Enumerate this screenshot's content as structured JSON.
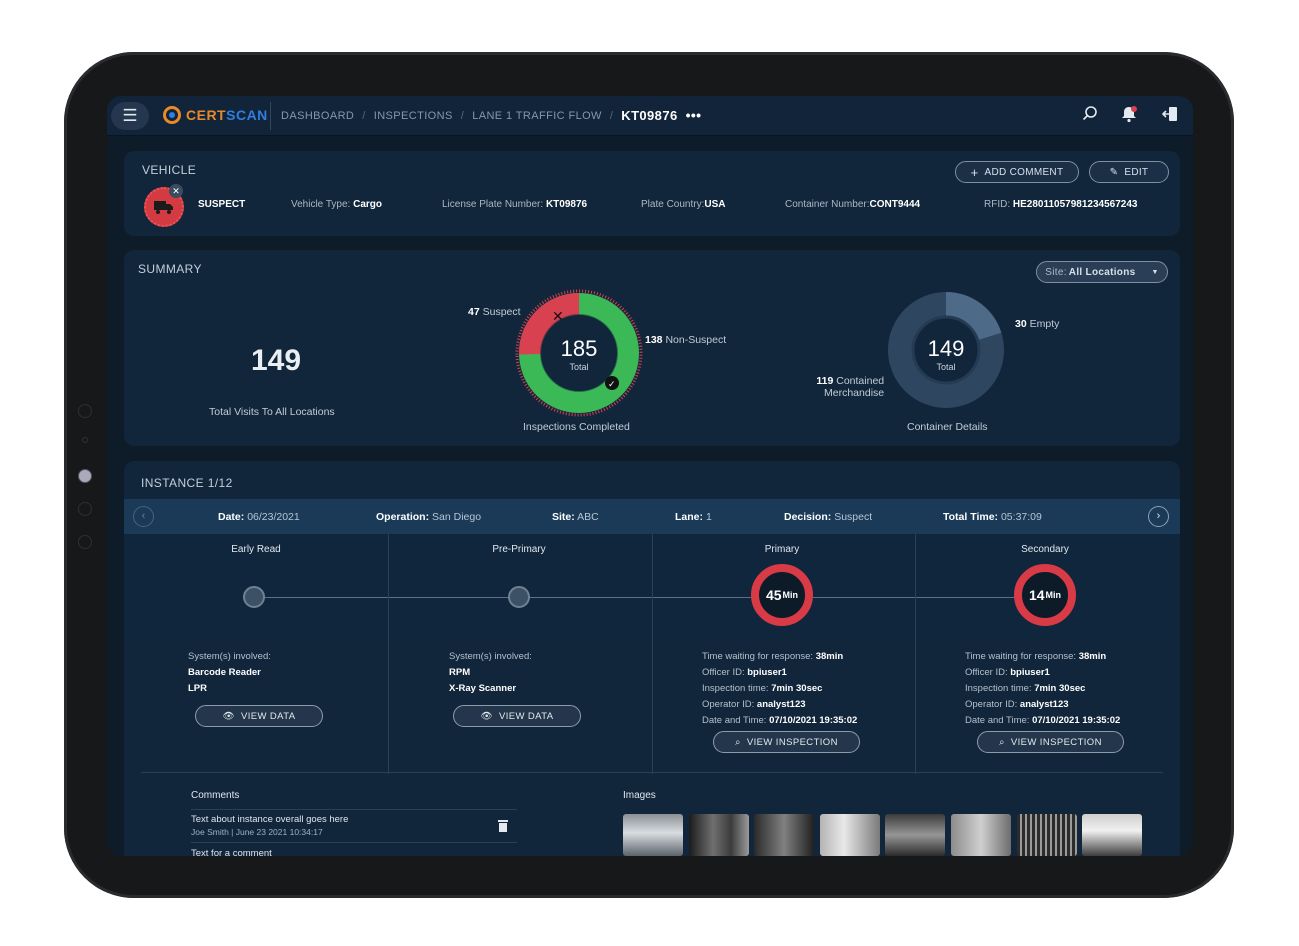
{
  "topbar": {
    "logo_part1": "CERT",
    "logo_part2": "SCAN",
    "crumbs": [
      "DASHBOARD",
      "INSPECTIONS",
      "LANE 1 TRAFFIC FLOW"
    ],
    "current": "KT09876",
    "more": "•••"
  },
  "vehicle": {
    "title": "VEHICLE",
    "add_comment": "ADD COMMENT",
    "edit": "EDIT",
    "status": "SUSPECT",
    "type_label": "Vehicle Type:",
    "type_value": "Cargo",
    "plate_label": "License Plate Number:",
    "plate_value": "KT09876",
    "country_label": "Plate Country:",
    "country_value": "USA",
    "container_label": "Container Number:",
    "container_value": "CONT9444",
    "rfid_label": "RFID:",
    "rfid_value": "HE2801105798123456724 3"
  },
  "summary": {
    "title": "SUMMARY",
    "site_label": "Site:",
    "site_value": "All Locations",
    "visits_value": "149",
    "visits_label": "Total Visits To All Locations",
    "inspections": {
      "total": "185",
      "total_label": "Total",
      "suspect_num": "47",
      "suspect_label": "Suspect",
      "nonsuspect_num": "138",
      "nonsuspect_label": "Non-Suspect",
      "caption": "Inspections Completed",
      "suspect_value": 47,
      "nonsuspect_value": 138,
      "suspect_color": "#d8414f",
      "nonsuspect_color": "#3cb957"
    },
    "containers": {
      "total": "149",
      "total_label": "Total",
      "empty_num": "30",
      "empty_label": "Empty",
      "contained_num": "119",
      "contained_label1": "Contained",
      "contained_label2": "Merchandise",
      "caption": "Container Details",
      "empty_value": 30,
      "contained_value": 119
    }
  },
  "instance": {
    "title": "INSTANCE 1/12",
    "date_label": "Date:",
    "date_value": "06/23/2021",
    "operation_label": "Operation:",
    "operation_value": "San Diego",
    "site_label": "Site:",
    "site_value": "ABC",
    "lane_label": "Lane:",
    "lane_value": "1",
    "decision_label": "Decision:",
    "decision_value": "Suspect",
    "time_label": "Total Time:",
    "time_value": "05:37:09",
    "stages": [
      {
        "title": "Early Read"
      },
      {
        "title": "Pre-Primary"
      },
      {
        "title": "Primary",
        "minutes": "45",
        "unit": "Min"
      },
      {
        "title": "Secondary",
        "minutes": "14",
        "unit": "Min"
      }
    ],
    "early": {
      "systems_label": "System(s) involved:",
      "sys1": "Barcode Reader",
      "sys2": "LPR",
      "button": "VIEW DATA"
    },
    "preprimary": {
      "systems_label": "System(s) involved:",
      "sys1": "RPM",
      "sys2": "X-Ray Scanner",
      "button": "VIEW DATA"
    },
    "primary": {
      "wait_label": "Time waiting for response:",
      "wait_value": "38min",
      "officer_label": "Officer ID:",
      "officer_value": "bpiuser1",
      "insp_label": "Inspection time:",
      "insp_value": "7min 30sec",
      "operator_label": "Operator ID:",
      "operator_value": "analyst123",
      "dt_label": "Date and Time:",
      "dt_value": "07/10/2021 19:35:02",
      "button": "VIEW INSPECTION"
    },
    "secondary": {
      "wait_label": "Time waiting for response:",
      "wait_value": "38min",
      "officer_label": "Officer ID:",
      "officer_value": "bpiuser1",
      "insp_label": "Inspection time:",
      "insp_value": "7min 30sec",
      "operator_label": "Operator ID:",
      "operator_value": "analyst123",
      "dt_label": "Date and Time:",
      "dt_value": "07/10/2021 19:35:02",
      "button": "VIEW INSPECTION"
    }
  },
  "comments": {
    "title": "Comments",
    "items": [
      {
        "text": "Text about instance overall goes here",
        "meta": "Joe Smith | June 23 2021 10:34:17"
      },
      {
        "text": "Text for a comment"
      }
    ]
  },
  "images": {
    "title": "Images"
  }
}
